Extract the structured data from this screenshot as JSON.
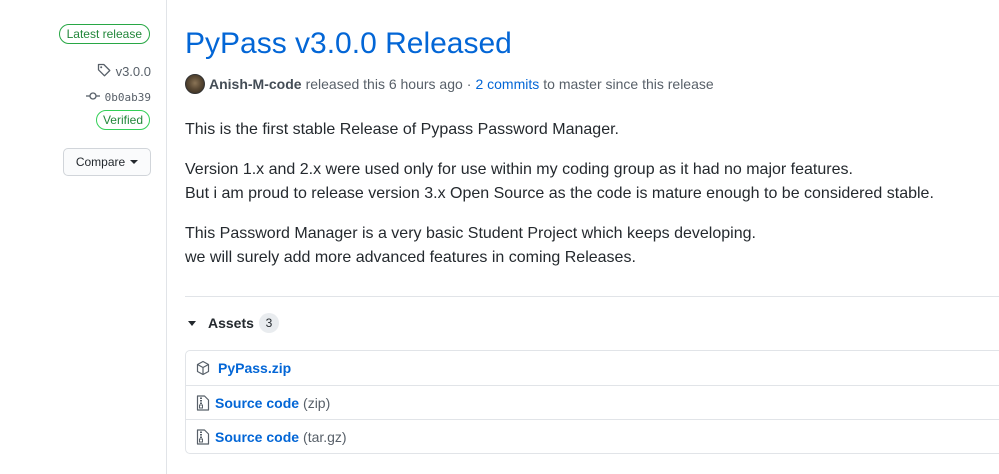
{
  "sidebar": {
    "latest_badge": "Latest release",
    "tag": "v3.0.0",
    "commit_sha": "0b0ab39",
    "verified": "Verified",
    "compare_label": "Compare"
  },
  "release": {
    "title": "PyPass v3.0.0 Released",
    "author": "Anish-M-code",
    "released_text": "released this 6 hours ago",
    "separator": "·",
    "commits_link": "2 commits",
    "commits_suffix": "to master since this release",
    "paragraphs": [
      "This is the first stable Release of Pypass Password Manager.",
      "Version 1.x and 2.x were used only for use within my coding group as it had no major features.",
      "But i am proud to release version 3.x Open Source as the code is mature enough to be considered stable.",
      "This Password Manager is a very basic Student Project which keeps developing.",
      "we will surely add more advanced features in coming Releases."
    ]
  },
  "assets": {
    "label": "Assets",
    "count": "3",
    "items": [
      {
        "name": "PyPass.zip",
        "suffix": "",
        "icon": "package-icon"
      },
      {
        "name": "Source code",
        "suffix": "(zip)",
        "icon": "file-zip-icon"
      },
      {
        "name": "Source code",
        "suffix": "(tar.gz)",
        "icon": "file-zip-icon"
      }
    ]
  },
  "colors": {
    "link": "#0366d6",
    "success": "#28a745",
    "muted": "#586069",
    "border": "#e1e4e8"
  }
}
